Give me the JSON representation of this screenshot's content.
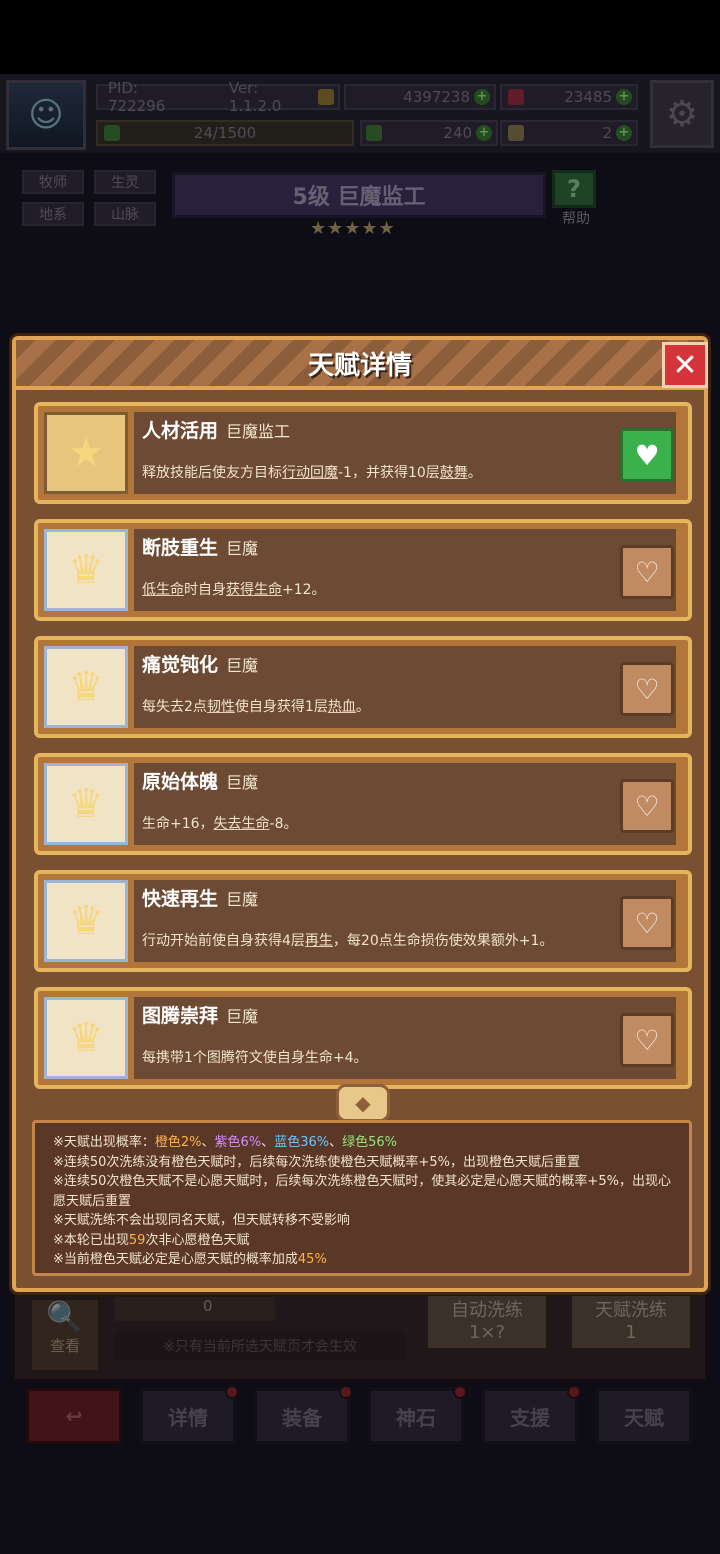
{
  "hud": {
    "pid": "PID: 722296",
    "version": "Ver: 1.1.2.0",
    "gold": "4397238",
    "gems": "23485",
    "stamina": "24/1500",
    "clover": "240",
    "key": "2"
  },
  "tags": [
    "牧师",
    "生灵",
    "地系",
    "山脉"
  ],
  "banner": {
    "level_title": "5级  巨魔监工",
    "stars": "★★★★★"
  },
  "help_label": "帮助",
  "modal": {
    "title": "天赋详情",
    "talents": [
      {
        "name": "人材活用",
        "race": "巨魔监工",
        "desc_parts": [
          "释放技能后使友方目标",
          "行动回魔",
          "-1，并获得10层",
          "鼓舞",
          "。"
        ]
      },
      {
        "name": "断肢重生",
        "race": "巨魔",
        "desc_parts": [
          "",
          "低生命",
          "时自身",
          "获得生命",
          "+12。"
        ]
      },
      {
        "name": "痛觉钝化",
        "race": "巨魔",
        "desc_parts": [
          "每失去2点",
          "韧性",
          "使自身获得1层",
          "热血",
          "。"
        ]
      },
      {
        "name": "原始体魄",
        "race": "巨魔",
        "desc_parts": [
          "生命+16，",
          "失去生命",
          "-8。",
          "",
          ""
        ]
      },
      {
        "name": "快速再生",
        "race": "巨魔",
        "desc_parts": [
          "行动开始前使自身获得4层",
          "再生",
          "，每20点生命损伤使效果额外+1。",
          "",
          ""
        ]
      },
      {
        "name": "图腾崇拜",
        "race": "巨魔",
        "desc_parts": [
          "每携带1个图腾符文使自身生命+4。",
          "",
          "",
          "",
          ""
        ]
      }
    ],
    "info": {
      "line1_prefix": "※天赋出现概率：",
      "orange": "橙色2%",
      "sep1": "、",
      "purple": "紫色6%",
      "sep2": "、",
      "blue": "蓝色36%",
      "sep3": "、",
      "green": "绿色56%",
      "line2": "※连续50次洗练没有橙色天赋时，后续每次洗练使橙色天赋概率+5%，出现橙色天赋后重置",
      "line3": "※连续50次橙色天赋不是心愿天赋时，后续每次洗练橙色天赋时，使其必定是心愿天赋的概率+5%，出现心愿天赋后重置",
      "line4": "※天赋洗练不会出现同名天赋，但天赋转移不受影响",
      "line5_prefix": "※本轮已出现",
      "line5_num": "59",
      "line5_suffix": "次非心愿橙色天赋",
      "line6_prefix": "※当前橙色天赋必定是心愿天赋的概率加成",
      "line6_num": "45%"
    }
  },
  "lower": {
    "count": "0",
    "hint": "※只有当前所选天赋页才会生效",
    "view_label": "查看",
    "auto_label": "自动洗练",
    "auto_cost": "1×?",
    "reroll_label": "天赋洗练",
    "reroll_cost": "1"
  },
  "nav": [
    "详情",
    "装备",
    "神石",
    "支援",
    "天赋"
  ],
  "colors": {
    "modal_border": "#e0a454",
    "active_heart": "#3cb04a",
    "close_red": "#d6343b"
  }
}
